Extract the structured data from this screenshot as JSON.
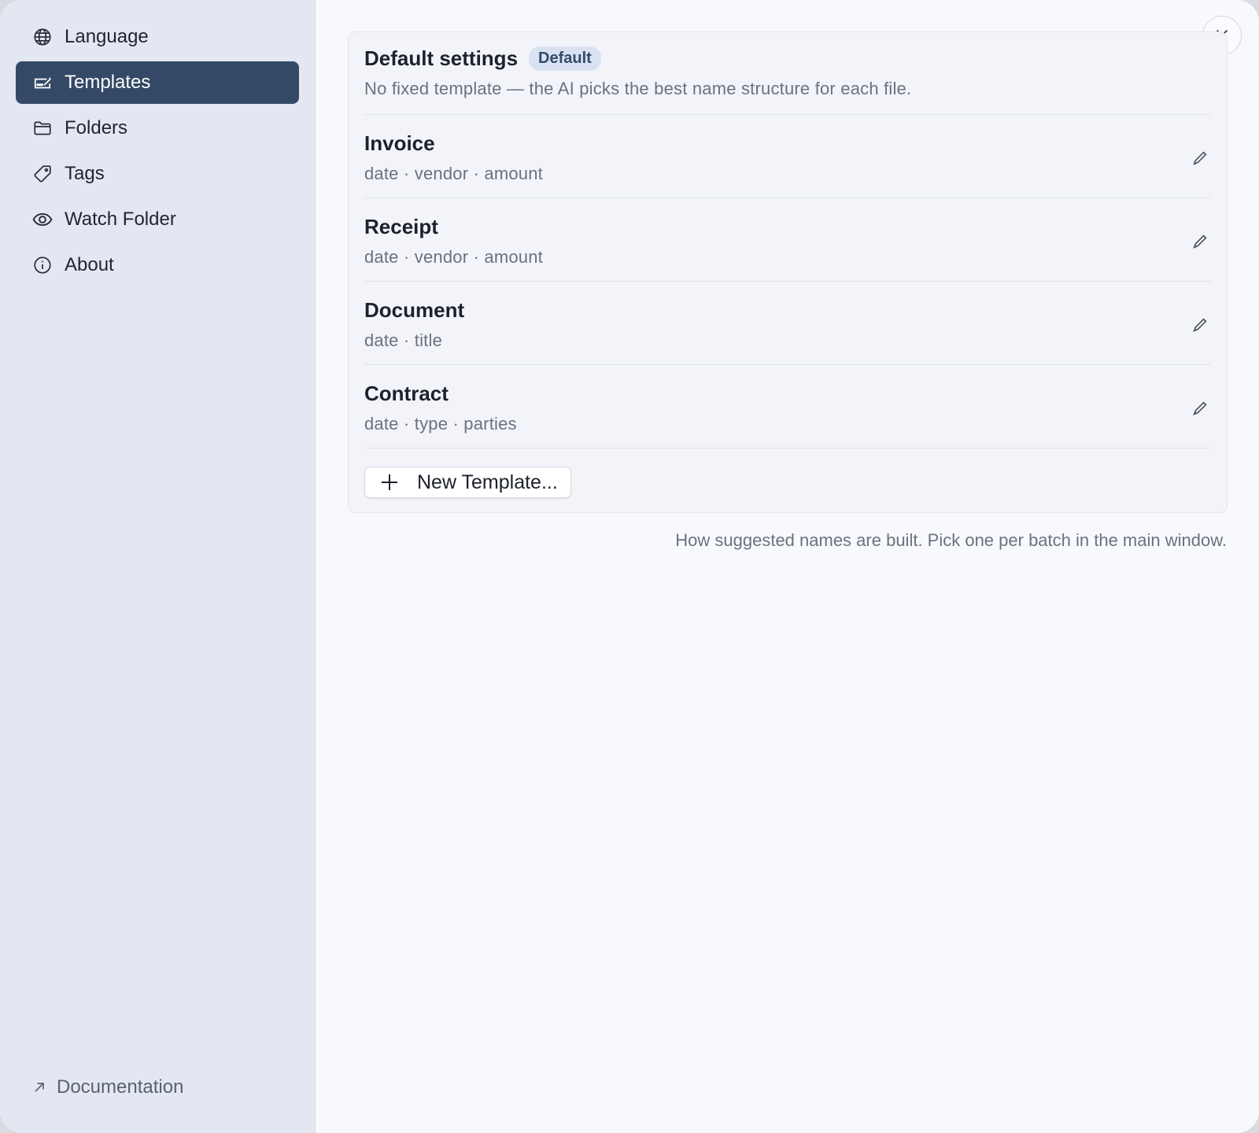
{
  "sidebar": {
    "items": [
      {
        "label": "Language",
        "icon": "globe-icon"
      },
      {
        "label": "Templates",
        "icon": "template-icon",
        "active": true
      },
      {
        "label": "Folders",
        "icon": "folder-icon"
      },
      {
        "label": "Tags",
        "icon": "tag-icon"
      },
      {
        "label": "Watch Folder",
        "icon": "eye-icon"
      },
      {
        "label": "About",
        "icon": "info-icon"
      }
    ],
    "documentation_label": "Documentation",
    "documentation_icon": "arrow-up-right-icon"
  },
  "main": {
    "close_icon": "close-icon",
    "default_row": {
      "title": "Default settings",
      "badge": "Default",
      "description": "No fixed template — the AI picks the best name structure for each file."
    },
    "templates": [
      {
        "name": "Invoice",
        "fields": "date · vendor · amount"
      },
      {
        "name": "Receipt",
        "fields": "date · vendor · amount"
      },
      {
        "name": "Document",
        "fields": "date · title"
      },
      {
        "name": "Contract",
        "fields": "date · type · parties"
      }
    ],
    "new_template_label": "New Template...",
    "footnote": "How suggested names are built. Pick one per batch in the main window."
  },
  "colors": {
    "sidebar_bg": "#e3e7f2",
    "active_bg": "#344966",
    "badge_bg": "#d9e2f2",
    "main_bg": "#f8f9fc"
  }
}
